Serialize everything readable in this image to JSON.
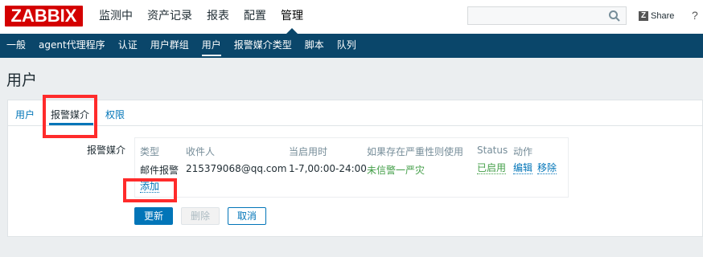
{
  "logo": "ZABBIX",
  "main_nav": [
    "监测中",
    "资产记录",
    "报表",
    "配置",
    "管理"
  ],
  "search": {
    "placeholder": ""
  },
  "share_label": "Share",
  "share_icon_glyph": "Z",
  "help_label": "?",
  "sub_nav": [
    "一般",
    "agent代理程序",
    "认证",
    "用户群组",
    "用户",
    "报警媒介类型",
    "脚本",
    "队列"
  ],
  "page_title": "用户",
  "tabs": [
    "用户",
    "报警媒介",
    "权限"
  ],
  "form": {
    "label": "报警媒介",
    "columns": [
      "类型",
      "收件人",
      "当启用时",
      "如果存在严重性则使用",
      "Status",
      "动作"
    ],
    "row": {
      "type": "邮件报警",
      "recipient": "215379068@qq.com",
      "when_active": "1-7,00:00-24:00",
      "severity": "未信警一严灾",
      "status": "已启用",
      "action_edit": "编辑",
      "action_remove": "移除"
    },
    "add_label": "添加"
  },
  "buttons": {
    "update": "更新",
    "delete": "删除",
    "cancel": "取消"
  },
  "colors": {
    "brand": "#d40000",
    "nav_bg": "#0a466a",
    "link": "#0275b8",
    "status_green": "#429e47",
    "highlight": "#ff2b2b"
  }
}
